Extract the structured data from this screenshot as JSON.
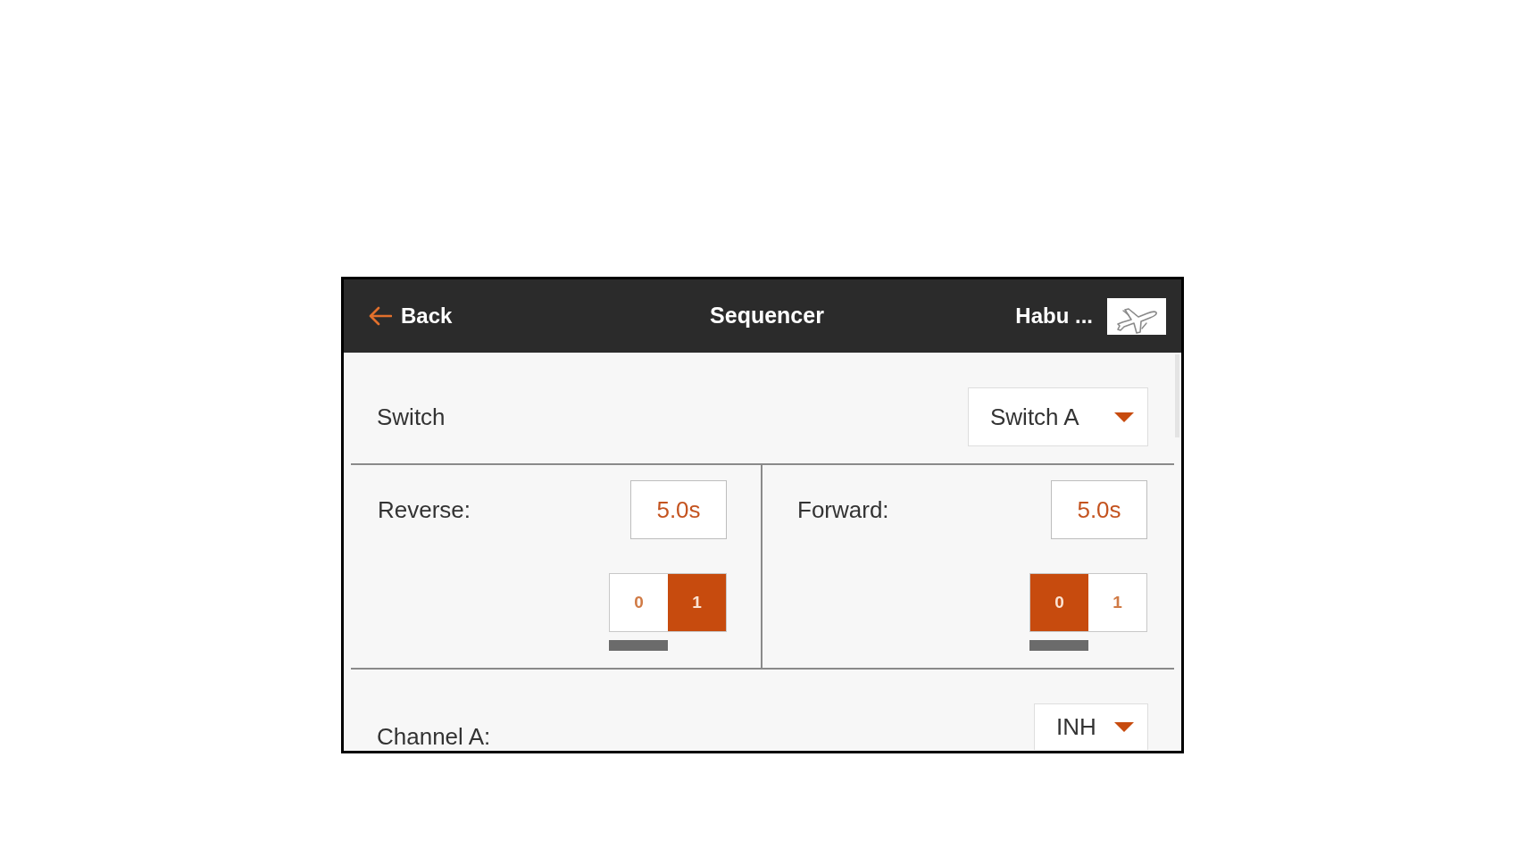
{
  "header": {
    "back_label": "Back",
    "title": "Sequencer",
    "model_name": "Habu ..."
  },
  "switch_row": {
    "label": "Switch",
    "value": "Switch A"
  },
  "sequence_steps": [
    {
      "label": "Reverse:",
      "time": "5.0s",
      "positions": [
        {
          "label": "0",
          "selected": false,
          "current": true
        },
        {
          "label": "1",
          "selected": true,
          "current": false
        }
      ]
    },
    {
      "label": "Forward:",
      "time": "5.0s",
      "positions": [
        {
          "label": "0",
          "selected": true,
          "current": true
        },
        {
          "label": "1",
          "selected": false,
          "current": false
        }
      ]
    }
  ],
  "channel_row": {
    "label": "Channel A:",
    "value": "INH"
  }
}
